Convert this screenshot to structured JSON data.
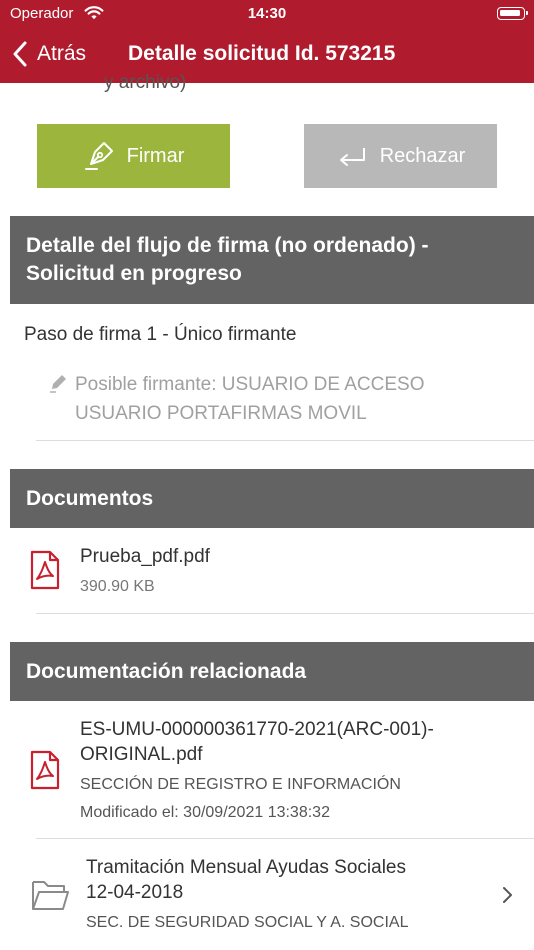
{
  "status_bar": {
    "carrier": "Operador",
    "time": "14:30"
  },
  "nav": {
    "back_label": "Atrás",
    "title": "Detalle solicitud Id. 573215"
  },
  "clipped_text": "y archivo)",
  "actions": {
    "sign_label": "Firmar",
    "reject_label": "Rechazar"
  },
  "flow": {
    "header_line1": "Detalle del flujo de firma (no ordenado) -",
    "header_line2": "Solicitud en progreso",
    "step_title": "Paso de firma 1 - Único firmante",
    "signer_line1": "Posible firmante: USUARIO DE ACCESO",
    "signer_line2": "USUARIO PORTAFIRMAS MOVIL"
  },
  "documents": {
    "header": "Documentos",
    "items": [
      {
        "name": "Prueba_pdf.pdf",
        "size": "390.90 KB"
      }
    ]
  },
  "related": {
    "header": "Documentación relacionada",
    "items": [
      {
        "name_line1": "ES-UMU-000000361770-2021(ARC-001)-",
        "name_line2": "ORIGINAL.pdf",
        "unit": "SECCIÓN DE REGISTRO E INFORMACIÓN",
        "modified": "Modificado el: 30/09/2021 13:38:32"
      },
      {
        "name_line1": "Tramitación Mensual Ayudas Sociales",
        "name_line2": "12-04-2018",
        "unit": "SEC. DE SEGURIDAD SOCIAL Y A. SOCIAL"
      }
    ]
  },
  "colors": {
    "nav_bar": "#b01c2e",
    "sign_button": "#9bb53d",
    "reject_button": "#b8b8b8",
    "section_header": "#636363",
    "pdf_icon": "#c8202f"
  },
  "icons": {
    "back": "chevron-left-icon",
    "sign": "pen-nib-icon",
    "reject": "return-arrow-icon",
    "signer": "pen-icon",
    "document": "pdf-file-icon",
    "folder": "folder-icon",
    "disclosure": "chevron-right-icon"
  }
}
